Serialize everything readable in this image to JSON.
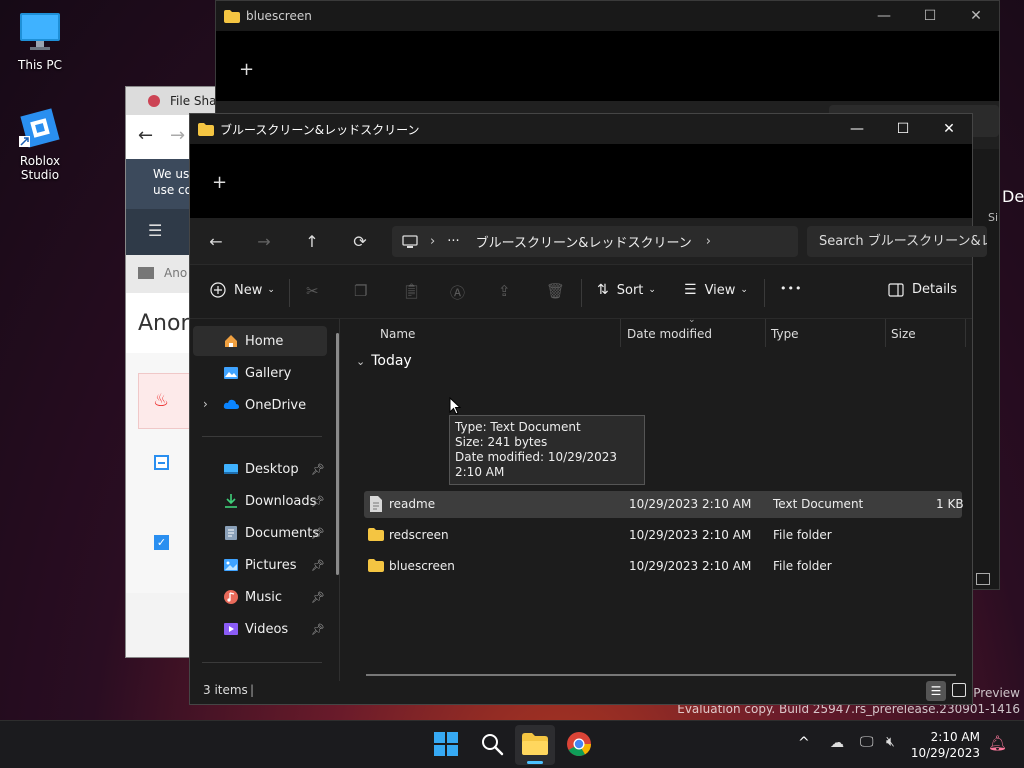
{
  "desktop": {
    "icons": [
      {
        "label": "This PC"
      },
      {
        "label": "Roblox Studio"
      }
    ],
    "watermark": {
      "line1": "r Preview",
      "line2": "Evaluation copy. Build 25947.rs_prerelease.230901-1416"
    }
  },
  "back_window": {
    "title": "bluescreen",
    "minimize": "—",
    "maximize": "☐",
    "close": "✕",
    "tab_add": "+",
    "right_fragment": "Det",
    "right_fragment2": "Si"
  },
  "browser_window": {
    "tab_title": "File Shar",
    "banner_line1": "We us",
    "banner_line2": "use co",
    "folder_label": "Ano",
    "heading": "Anon"
  },
  "explorer": {
    "title": "ブルースクリーン&レッドスクリーン",
    "controls": {
      "minimize": "—",
      "maximize": "☐",
      "close": "✕"
    },
    "tab_add": "+",
    "address": {
      "ellipsis": "···",
      "crumb": "ブルースクリーン&レッドスクリーン",
      "sep": "›"
    },
    "search_placeholder": "Search ブルースクリーン&レッドスクリーン",
    "toolbar": {
      "new_label": "New",
      "sort_label": "Sort",
      "view_label": "View",
      "more_label": "•••",
      "details_label": "Details"
    },
    "nav": [
      {
        "label": "Home"
      },
      {
        "label": "Gallery"
      },
      {
        "label": "OneDrive"
      },
      {
        "label": "Desktop"
      },
      {
        "label": "Downloads"
      },
      {
        "label": "Documents"
      },
      {
        "label": "Pictures"
      },
      {
        "label": "Music"
      },
      {
        "label": "Videos"
      }
    ],
    "columns": {
      "name": "Name",
      "date": "Date modified",
      "type": "Type",
      "size": "Size"
    },
    "group_label": "Today",
    "files": [
      {
        "name": "readme",
        "date": "10/29/2023 2:10 AM",
        "type": "Text Document",
        "size": "1 KB"
      },
      {
        "name": "redscreen",
        "date": "10/29/2023 2:10 AM",
        "type": "File folder",
        "size": ""
      },
      {
        "name": "bluescreen",
        "date": "10/29/2023 2:10 AM",
        "type": "File folder",
        "size": ""
      }
    ],
    "tooltip": {
      "line1": "Type: Text Document",
      "line2": "Size: 241 bytes",
      "line3": "Date modified: 10/29/2023 2:10 AM"
    },
    "status": {
      "count": "3 items",
      "divider": "|"
    }
  },
  "taskbar": {
    "time": "2:10 AM",
    "date": "10/29/2023",
    "tray_chevron": "^"
  },
  "colors": {
    "folder": "#f4c542",
    "accent": "#4cc2ff",
    "onedrive": "#0a84ff"
  }
}
